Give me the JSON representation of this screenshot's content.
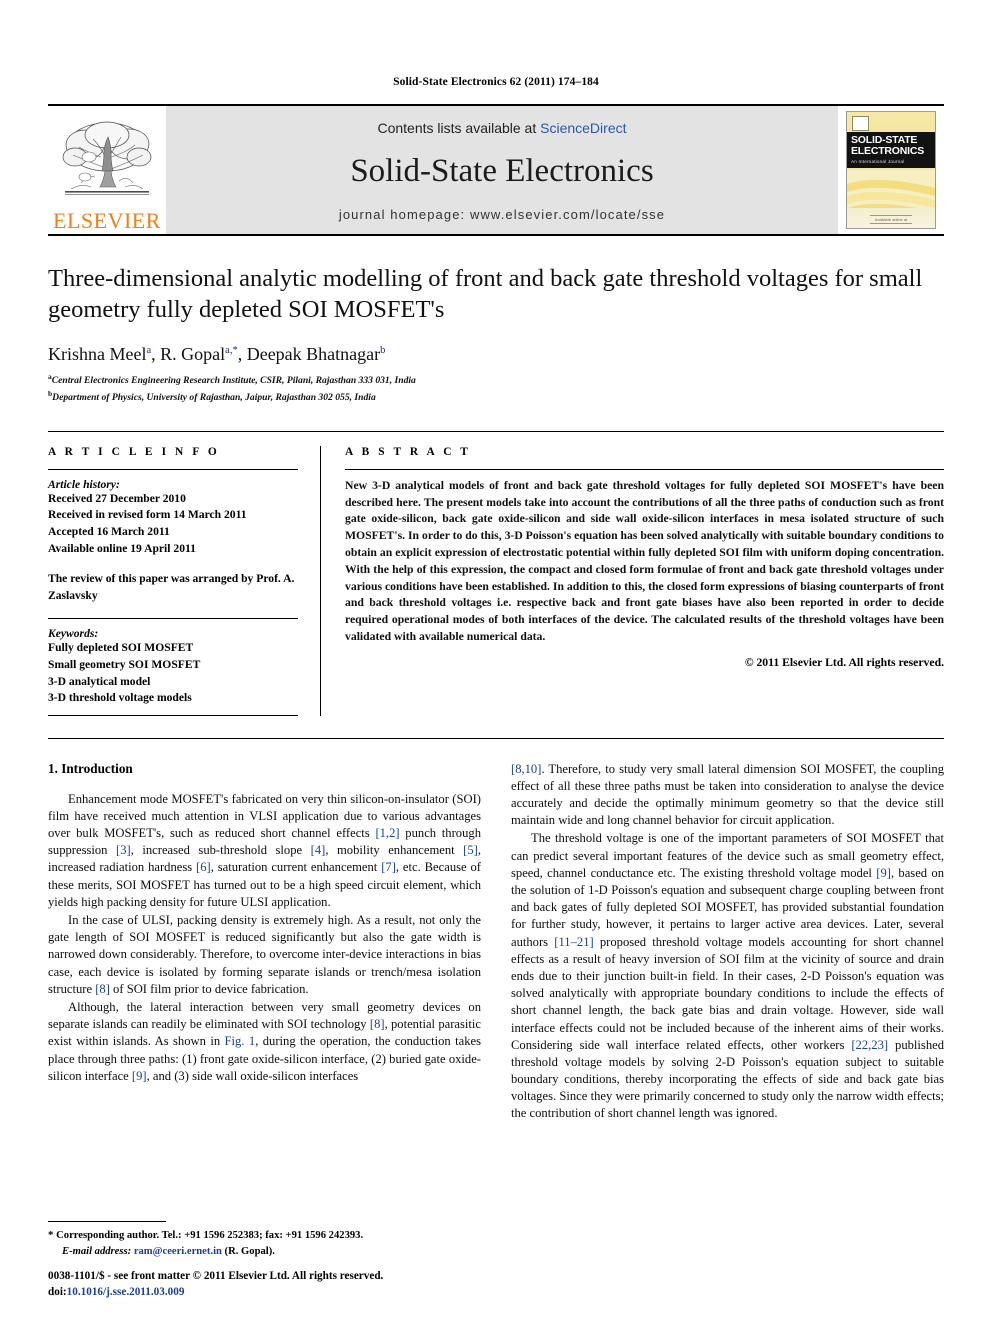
{
  "running_head": "Solid-State Electronics 62 (2011) 174–184",
  "masthead": {
    "publisher_name": "ELSEVIER",
    "contents_prefix": "Contents lists available at ",
    "contents_link": "ScienceDirect",
    "journal_title": "Solid-State Electronics",
    "homepage": "journal homepage: www.elsevier.com/locate/sse",
    "cover": {
      "line1": "SOLID-STATE",
      "line2": "ELECTRONICS",
      "line3": "An International Journal",
      "foot": "Available online at"
    }
  },
  "article": {
    "title": "Three-dimensional analytic modelling of front and back gate threshold voltages for small geometry fully depleted SOI MOSFET's",
    "authors": [
      {
        "name": "Krishna Meel",
        "marks": "a"
      },
      {
        "name": "R. Gopal",
        "marks": "a,*"
      },
      {
        "name": "Deepak Bhatnagar",
        "marks": "b"
      }
    ],
    "affiliations": [
      {
        "mark": "a",
        "text": "Central Electronics Engineering Research Institute, CSIR, Pilani, Rajasthan 333 031, India"
      },
      {
        "mark": "b",
        "text": "Department of Physics, University of Rajasthan, Jaipur, Rajasthan 302 055, India"
      }
    ]
  },
  "article_info": {
    "heading": "A R T I C L E    I N F O",
    "history_label": "Article history:",
    "history": [
      "Received 27 December 2010",
      "Received in revised form 14 March 2011",
      "Accepted 16 March 2011",
      "Available online 19 April 2011"
    ],
    "review_note": "The review of this paper was arranged by Prof. A. Zaslavsky",
    "keywords_label": "Keywords:",
    "keywords": [
      "Fully depleted SOI MOSFET",
      "Small geometry SOI MOSFET",
      "3-D analytical model",
      "3-D threshold voltage models"
    ]
  },
  "abstract": {
    "heading": "A B S T R A C T",
    "text": "New 3-D analytical models of front and back gate threshold voltages for fully depleted SOI MOSFET's have been described here. The present models take into account the contributions of all the three paths of conduction such as front gate oxide-silicon, back gate oxide-silicon and side wall oxide-silicon interfaces in mesa isolated structure of such MOSFET's. In order to do this, 3-D Poisson's equation has been solved analytically with suitable boundary conditions to obtain an explicit expression of electrostatic potential within fully depleted SOI film with uniform doping concentration. With the help of this expression, the compact and closed form formulae of front and back gate threshold voltages under various conditions have been established. In addition to this, the closed form expressions of biasing counterparts of front and back threshold voltages i.e. respective back and front gate biases have also been reported in order to decide required operational modes of both interfaces of the device. The calculated results of the threshold voltages have been validated with available numerical data.",
    "copyright": "© 2011 Elsevier Ltd. All rights reserved."
  },
  "body": {
    "section_heading": "1. Introduction",
    "left_paragraphs": [
      [
        {
          "t": "Enhancement mode MOSFET's fabricated on very thin silicon-on-insulator (SOI) film have received much attention in VLSI application due to various advantages over bulk MOSFET's, such as reduced short channel effects "
        },
        {
          "t": "[1,2]",
          "ref": true
        },
        {
          "t": " punch through suppression "
        },
        {
          "t": "[3]",
          "ref": true
        },
        {
          "t": ", increased sub-threshold slope "
        },
        {
          "t": "[4]",
          "ref": true
        },
        {
          "t": ", mobility enhancement "
        },
        {
          "t": "[5]",
          "ref": true
        },
        {
          "t": ", increased radiation hardness "
        },
        {
          "t": "[6]",
          "ref": true
        },
        {
          "t": ", saturation current enhancement "
        },
        {
          "t": "[7]",
          "ref": true
        },
        {
          "t": ", etc. Because of these merits, SOI MOSFET has turned out to be a high speed circuit element, which yields high packing density for future ULSI application."
        }
      ],
      [
        {
          "t": "In the case of ULSI, packing density is extremely high. As a result, not only the gate length of SOI MOSFET is reduced significantly but also the gate width is narrowed down considerably. Therefore, to overcome inter-device interactions in bias case, each device is isolated by forming separate islands or trench/mesa isolation structure "
        },
        {
          "t": "[8]",
          "ref": true
        },
        {
          "t": " of SOI film prior to device fabrication."
        }
      ],
      [
        {
          "t": "Although, the lateral interaction between very small geometry devices on separate islands can readily be eliminated with SOI technology "
        },
        {
          "t": "[8]",
          "ref": true
        },
        {
          "t": ", potential parasitic exist within islands. As shown in "
        },
        {
          "t": "Fig. 1",
          "ref": true
        },
        {
          "t": ", during the operation, the conduction takes place through three paths: (1) front gate oxide-silicon interface, (2) buried gate oxide-silicon interface "
        },
        {
          "t": "[9]",
          "ref": true
        },
        {
          "t": ", and (3) side wall oxide-silicon interfaces"
        }
      ]
    ],
    "right_paragraphs": [
      [
        {
          "t": "[8,10]",
          "ref": true
        },
        {
          "t": ". Therefore, to study very small lateral dimension SOI MOSFET, the coupling effect of all these three paths must be taken into consideration to analyse the device accurately and decide the optimally minimum geometry so that the device still maintain wide and long channel behavior for circuit application."
        }
      ],
      [
        {
          "t": "The threshold voltage is one of the important parameters of SOI MOSFET that can predict several important features of the device such as small geometry effect, speed, channel conductance etc. The existing threshold voltage model "
        },
        {
          "t": "[9]",
          "ref": true
        },
        {
          "t": ", based on the solution of 1-D Poisson's equation and subsequent charge coupling between front and back gates of fully depleted SOI MOSFET, has provided substantial foundation for further study, however, it pertains to larger active area devices. Later, several authors "
        },
        {
          "t": "[11–21]",
          "ref": true
        },
        {
          "t": " proposed threshold voltage models accounting for short channel effects as a result of heavy inversion of SOI film at the vicinity of source and drain ends due to their junction built-in field. In their cases, 2-D Poisson's equation was solved analytically with appropriate boundary conditions to include the effects of short channel length, the back gate bias and drain voltage. However, side wall interface effects could not be included because of the inherent aims of their works. Considering side wall interface related effects, other workers "
        },
        {
          "t": "[22,23]",
          "ref": true
        },
        {
          "t": " published threshold voltage models by solving 2-D Poisson's equation subject to suitable boundary conditions, thereby incorporating the effects of side and back gate bias voltages. Since they were primarily concerned to study only the narrow width effects; the contribution of short channel length was ignored."
        }
      ]
    ]
  },
  "footnote": {
    "star": "*",
    "corresponding": " Corresponding author. Tel.: +91 1596 252383; fax: +91 1596 242393.",
    "email_label": "E-mail address:",
    "email": "ram@ceeri.ernet.in",
    "email_suffix": " (R. Gopal)."
  },
  "footer": {
    "front_matter": "0038-1101/$ - see front matter © 2011 Elsevier Ltd. All rights reserved.",
    "doi_label": "doi:",
    "doi": "10.1016/j.sse.2011.03.009"
  }
}
